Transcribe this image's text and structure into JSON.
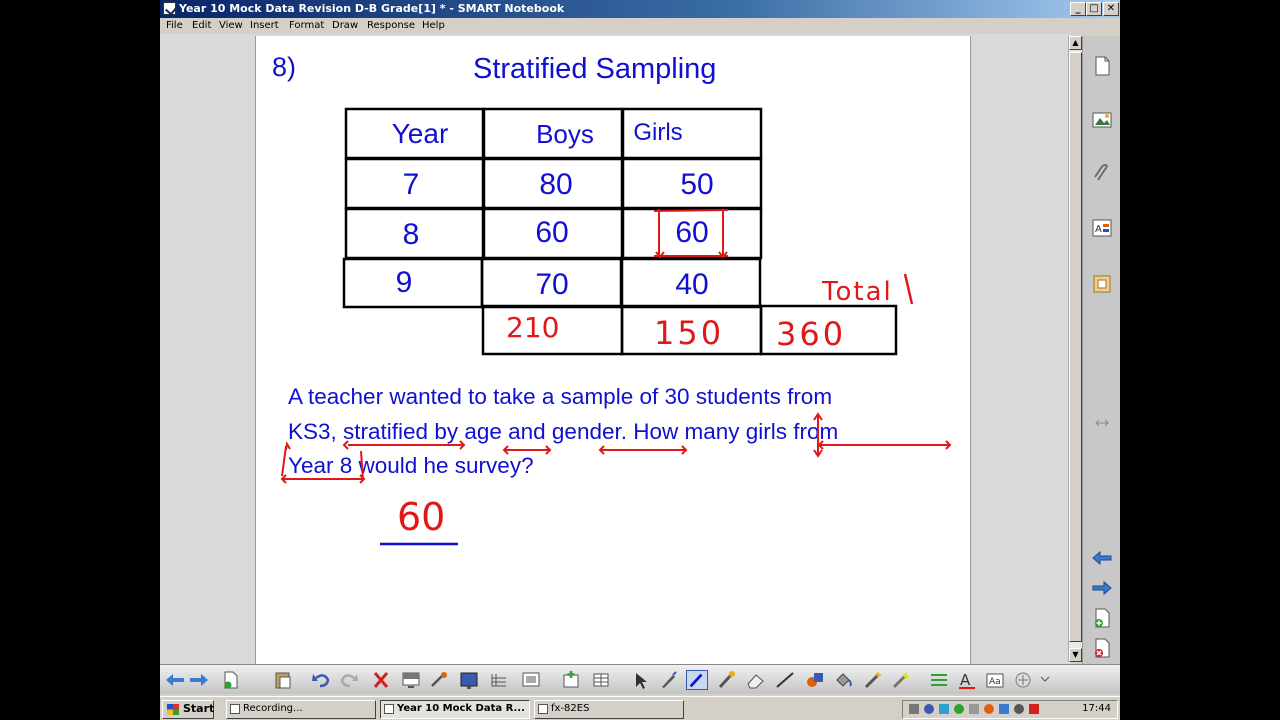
{
  "window": {
    "title": "Year 10 Mock Data Revision D-B Grade[1] * - SMART Notebook",
    "buttons": {
      "minimize": "_",
      "maximize": "□",
      "close": "✕"
    }
  },
  "menu": [
    "File",
    "Edit",
    "View",
    "Insert",
    "Format",
    "Draw",
    "Response",
    "Help"
  ],
  "slide": {
    "question_number": "8)",
    "title": "Stratified Sampling",
    "table": {
      "headers": [
        "Year",
        "Boys",
        "Girls"
      ],
      "rows": [
        [
          "7",
          "80",
          "50"
        ],
        [
          "8",
          "60",
          "60"
        ],
        [
          "9",
          "70",
          "40"
        ]
      ]
    },
    "question_lines": [
      "A teacher wanted to take a sample of 30 students from",
      "KS3, stratified by age and gender. How many girls from",
      "Year 8 would he survey?"
    ],
    "handwritten": {
      "total_label": "Total",
      "boys_total": "210",
      "girls_total": "150",
      "grand_total": "360",
      "answer": "60"
    }
  },
  "taskbar": {
    "start": "Start",
    "tasks": [
      "Recording...",
      "Year 10 Mock Data R...",
      "fx-82ES"
    ],
    "clock": "17:44"
  },
  "colors": {
    "ink_blue": "#1010d0",
    "ink_red": "#e01818",
    "title_bar": "#0a246a"
  }
}
